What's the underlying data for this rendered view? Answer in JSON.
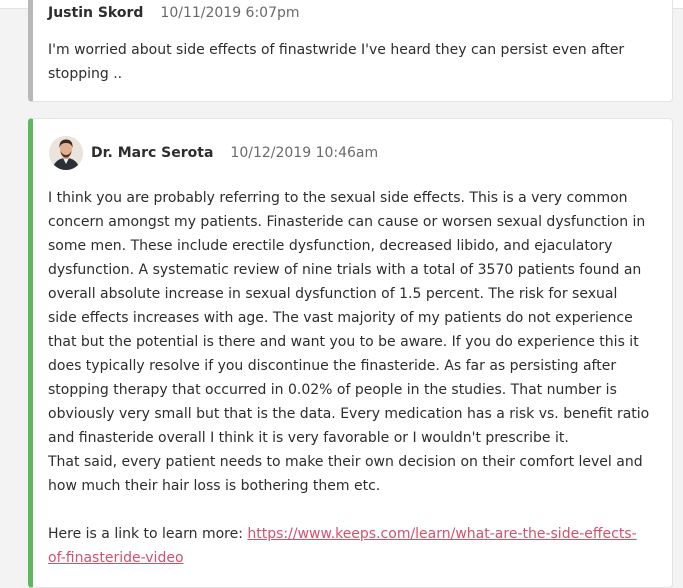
{
  "comments": [
    {
      "author": "Justin Skord",
      "timestamp": "10/11/2019 6:07pm",
      "body": "I'm worried about side effects of finastwride I've heard they can persist even after stopping .."
    },
    {
      "author": "Dr. Marc Serota",
      "timestamp": "10/12/2019 10:46am",
      "paragraph1": "I think you are probably referring to the sexual side effects. This is a very common concern amongst my patients. Finasteride can cause or worsen sexual dysfunction in some men. These include erectile dysfunction, decreased libido, and ejaculatory dysfunction. A systematic review of nine trials with a total of 3570 patients found an overall absolute increase in sexual dysfunction of 1.5 percent. The risk for sexual side effects increases with age. The vast majority of my patients do not experience that but the potential is there and want you to be aware. If you do experience this it does typically resolve if you discontinue the finasteride. As far as persisting after stopping therapy that occurred in 0.02% of people in the studies. That number is obviously very small but that is the data. Every medication has a risk vs. benefit ratio and finasteride overall I think it is very favorable or I wouldn't prescribe it.",
      "paragraph2": "That said, every patient needs to make their own decision on their comfort level and how much their hair loss is bothering them etc.",
      "link_prefix": "Here is a link to learn more: ",
      "link_text": "https://www.keeps.com/learn/what-are-the-side-effects-of-finasteride-video"
    }
  ],
  "colors": {
    "accent_green": "#5cb85c",
    "link": "#d4506b",
    "border_gray": "#b8b8b8"
  }
}
